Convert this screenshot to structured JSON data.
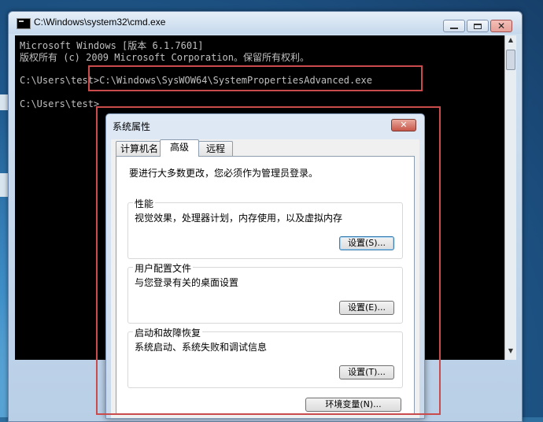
{
  "cmd_window": {
    "title": "C:\\Windows\\system32\\cmd.exe",
    "min_symbol": "",
    "max_symbol": "",
    "close_symbol": "✕",
    "lines": [
      "Microsoft Windows [版本 6.1.7601]",
      "版权所有 (c) 2009 Microsoft Corporation。保留所有权利。",
      "C:\\Users\\test>C:\\Windows\\SysWOW64\\SystemPropertiesAdvanced.exe",
      "C:\\Users\\test>"
    ]
  },
  "dialog": {
    "title": "系统属性",
    "close_symbol": "✕",
    "tabs": [
      "计算机名",
      "高级",
      "远程"
    ],
    "notice": "要进行大多数更改，您必须作为管理员登录。",
    "groups": {
      "performance": {
        "title": "性能",
        "desc": "视觉效果，处理器计划，内存使用，以及虚拟内存",
        "button": "设置(S)..."
      },
      "profile": {
        "title": "用户配置文件",
        "desc": "与您登录有关的桌面设置",
        "button": "设置(E)..."
      },
      "startup": {
        "title": "启动和故障恢复",
        "desc": "系统启动、系统失败和调试信息",
        "button": "设置(T)..."
      }
    },
    "env_button": "环境变量(N)..."
  },
  "colors": {
    "highlight": "#c94b4b",
    "console_bg": "#000000",
    "console_text": "#c0c0c0"
  }
}
